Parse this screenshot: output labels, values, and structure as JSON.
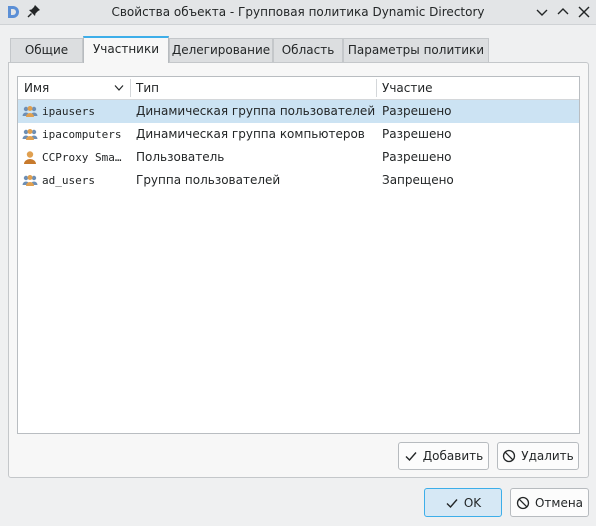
{
  "window": {
    "title": "Свойства объекта - Групповая политика Dynamic Directory"
  },
  "tabs": [
    {
      "label": "Общие"
    },
    {
      "label": "Участники"
    },
    {
      "label": "Делегирование"
    },
    {
      "label": "Область"
    },
    {
      "label": "Параметры политики"
    }
  ],
  "active_tab": "Участники",
  "table": {
    "columns": {
      "name": "Имя",
      "type": "Тип",
      "membership": "Участие"
    },
    "rows": [
      {
        "name": "ipausers",
        "type": "Динамическая группа пользователей",
        "membership": "Разрешено",
        "icon": "group-icon",
        "selected": true
      },
      {
        "name": "ipacomputers",
        "type": "Динамическая группа компьютеров",
        "membership": "Разрешено",
        "icon": "group-icon",
        "selected": false
      },
      {
        "name": "CCProxy Sma…",
        "type": "Пользователь",
        "membership": "Разрешено",
        "icon": "user-icon",
        "selected": false
      },
      {
        "name": "ad_users",
        "type": "Группа пользователей",
        "membership": "Запрещено",
        "icon": "group-icon",
        "selected": false
      }
    ]
  },
  "buttons": {
    "add": "Добавить",
    "remove": "Удалить",
    "ok": "OK",
    "cancel": "Отмена"
  },
  "colors": {
    "accent": "#3daee9",
    "selection": "#cce3f3"
  }
}
